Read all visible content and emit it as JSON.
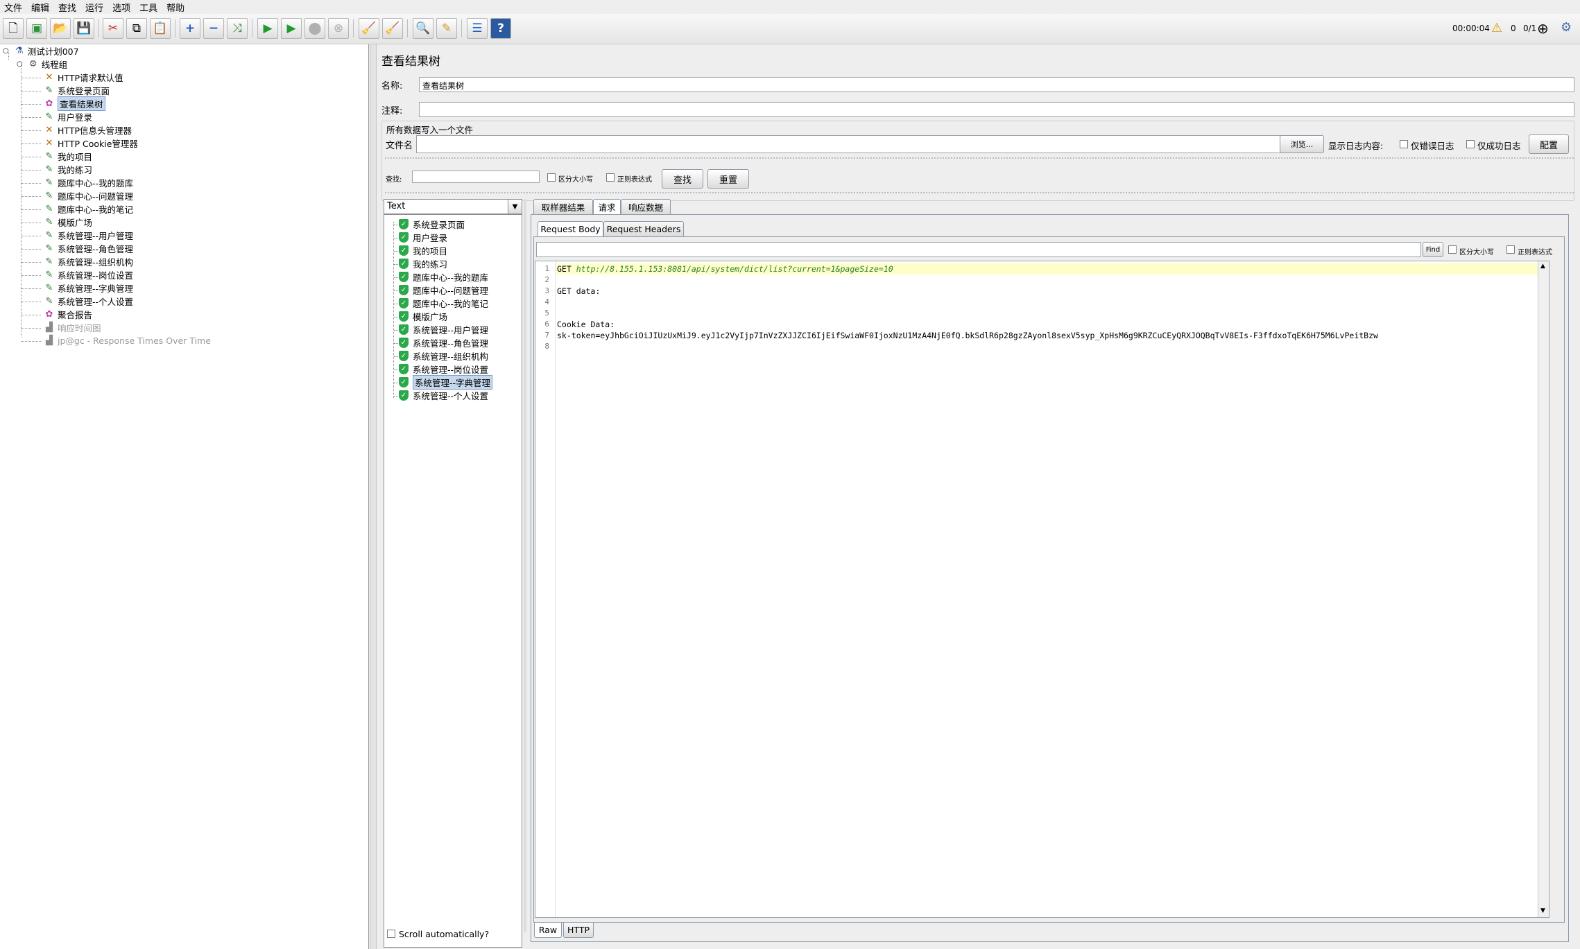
{
  "menu": [
    "文件",
    "编辑",
    "查找",
    "运行",
    "选项",
    "工具",
    "帮助"
  ],
  "toolbar_status": {
    "elapsed": "00:00:04",
    "warnings": "0",
    "threads": "0/1"
  },
  "tree": {
    "plan": "测试计划007",
    "group": "线程组",
    "items": [
      {
        "label": "HTTP请求默认值",
        "icon": "wrench-icon"
      },
      {
        "label": "系统登录页面",
        "icon": "sampler-icon"
      },
      {
        "label": "查看结果树",
        "icon": "listener-icon"
      },
      {
        "label": "用户登录",
        "icon": "sampler-icon"
      },
      {
        "label": "HTTP信息头管理器",
        "icon": "wrench-icon"
      },
      {
        "label": "HTTP Cookie管理器",
        "icon": "wrench-icon"
      },
      {
        "label": "我的项目",
        "icon": "sampler-icon"
      },
      {
        "label": "我的练习",
        "icon": "sampler-icon"
      },
      {
        "label": "题库中心--我的题库",
        "icon": "sampler-icon"
      },
      {
        "label": "题库中心--问题管理",
        "icon": "sampler-icon"
      },
      {
        "label": "题库中心--我的笔记",
        "icon": "sampler-icon"
      },
      {
        "label": "模版广场",
        "icon": "sampler-icon"
      },
      {
        "label": "系统管理--用户管理",
        "icon": "sampler-icon"
      },
      {
        "label": "系统管理--角色管理",
        "icon": "sampler-icon"
      },
      {
        "label": "系统管理--组织机构",
        "icon": "sampler-icon"
      },
      {
        "label": "系统管理--岗位设置",
        "icon": "sampler-icon"
      },
      {
        "label": "系统管理--字典管理",
        "icon": "sampler-icon"
      },
      {
        "label": "系统管理--个人设置",
        "icon": "sampler-icon"
      },
      {
        "label": "聚合报告",
        "icon": "listener-icon"
      },
      {
        "label": "响应时间图",
        "icon": "graph-icon"
      },
      {
        "label": "jp@gc - Response Times Over Time",
        "icon": "graph-icon"
      }
    ]
  },
  "panel": {
    "title": "查看结果树",
    "name_label": "名称:",
    "name_value": "查看结果树",
    "comment_label": "注释:",
    "comment_value": "",
    "file_section": "所有数据写入一个文件",
    "filename_label": "文件名",
    "filename_value": "",
    "browse": "浏览...",
    "log_label": "显示日志内容:",
    "errors_only": "仅错误日志",
    "success_only": "仅成功日志",
    "configure": "配置"
  },
  "search": {
    "label": "查找:",
    "value": "",
    "case_sensitive": "区分大小写",
    "regex": "正则表达式",
    "find": "查找",
    "reset": "重置"
  },
  "renderer": "Text",
  "results": [
    "系统登录页面",
    "用户登录",
    "我的项目",
    "我的练习",
    "题库中心--我的题库",
    "题库中心--问题管理",
    "题库中心--我的笔记",
    "模版广场",
    "系统管理--用户管理",
    "系统管理--角色管理",
    "系统管理--组织机构",
    "系统管理--岗位设置",
    "系统管理--字典管理",
    "系统管理--个人设置"
  ],
  "scroll_auto": "Scroll automatically?",
  "tabs": [
    "取样器结果",
    "请求",
    "响应数据"
  ],
  "subtabs": [
    "Request Body",
    "Request Headers"
  ],
  "editor_search": {
    "find": "Find",
    "case": "区分大小写",
    "regex": "正则表达式"
  },
  "code": {
    "line1_method": "GET ",
    "line1_url": "http://8.155.1.153:8081/api/system/dict/list?current=1&pageSize=10",
    "line3": "GET data:",
    "line6": "Cookie Data:",
    "line7": "sk-token=eyJhbGciOiJIUzUxMiJ9.eyJ1c2VyIjp7InVzZXJJZCI6IjEifSwiaWF0IjoxNzU1MzA4NjE0fQ.bkSdlR6p28gzZAyonl8sexV5syp_XpHsM6g9KRZCuCEyQRXJOQBqTvV8EIs-F3ffdxoTqEK6H75M6LvPeitBzw"
  },
  "bottom_tabs": [
    "Raw",
    "HTTP"
  ]
}
